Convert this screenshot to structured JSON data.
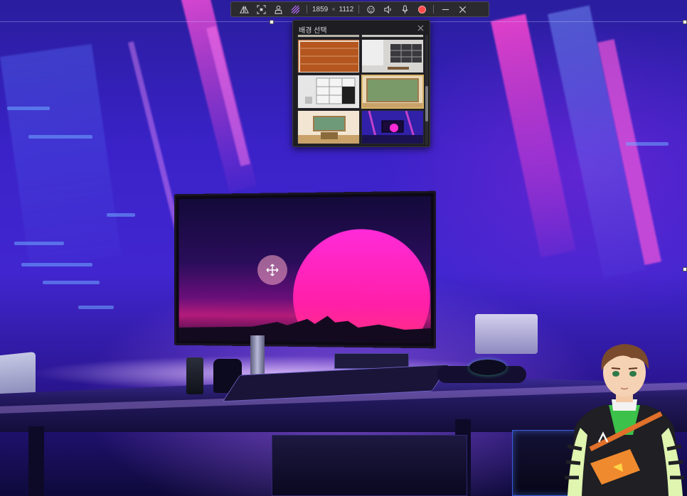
{
  "toolbar": {
    "width_value": "1859",
    "separator": "×",
    "height_value": "1112",
    "icons": [
      "mirror-icon",
      "crop-screen-icon",
      "person-icon",
      "stripes-icon",
      "face-icon",
      "speaker-icon",
      "microphone-icon",
      "record-icon",
      "minimize-icon",
      "close-icon"
    ],
    "record_color": "#ff4b4b"
  },
  "background_picker": {
    "title": "배경 선택",
    "thumbnails": [
      {
        "name": "brick-wall",
        "selected": false
      },
      {
        "name": "studio-room",
        "selected": false
      },
      {
        "name": "shelf-room",
        "selected": false
      },
      {
        "name": "green-chalkboard",
        "selected": false
      },
      {
        "name": "classroom-chalkboard",
        "selected": false
      },
      {
        "name": "neon-desk-setup",
        "selected": true
      }
    ],
    "selected_color": "#d8b46a"
  },
  "scene": {
    "accent": "#ff2bd8",
    "primary": "#4126cf"
  }
}
